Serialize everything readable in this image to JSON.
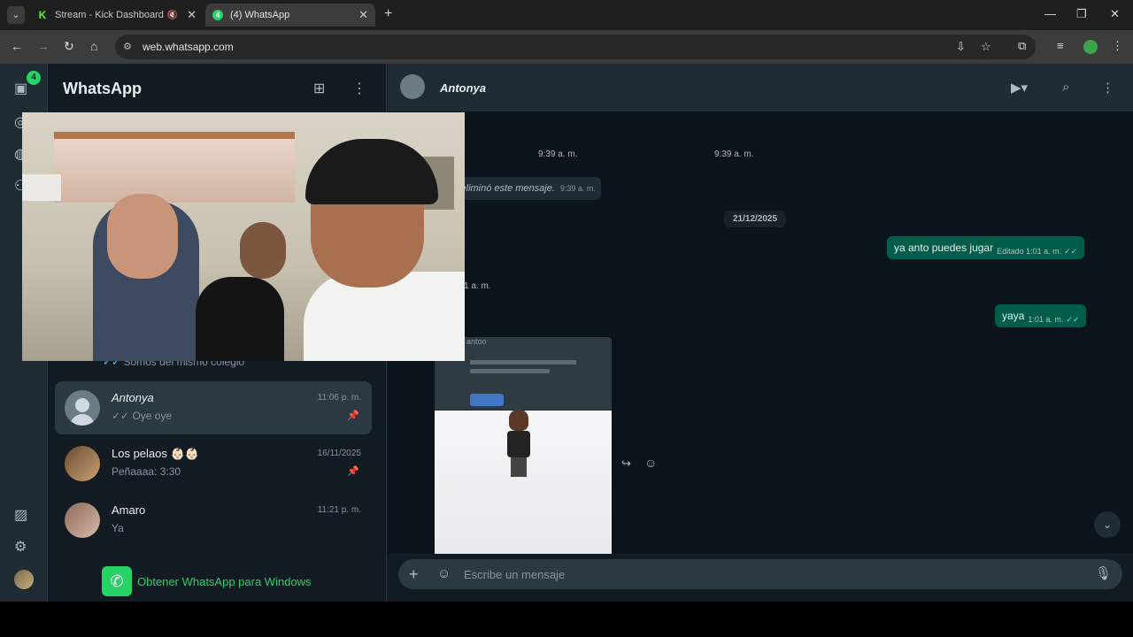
{
  "browser": {
    "tabs": [
      {
        "title": "Stream - Kick Dashboard",
        "favicon": "K"
      },
      {
        "title": "(4) WhatsApp",
        "favicon": "4"
      }
    ],
    "url": "web.whatsapp.com"
  },
  "rail": {
    "unread_badge": "4"
  },
  "sidebar": {
    "brand": "WhatsApp",
    "partial_preview": "Somos del mismo colegio",
    "chats": [
      {
        "name": "Antonya",
        "time": "11:06 p. m.",
        "preview": "✓✓ Oye oye",
        "pinned": true,
        "active": true
      },
      {
        "name": "Los pelaos 👶🏻👶🏻",
        "time": "16/11/2025",
        "preview": "Peñaaaa: 3:30",
        "pinned": true,
        "active": false
      },
      {
        "name": "Amaro",
        "time": "11:21 p. m.",
        "preview": "Ya",
        "pinned": false,
        "active": false
      }
    ],
    "get_app": "Obtener WhatsApp para Windows"
  },
  "chat": {
    "contact": "Antonya",
    "stamps": [
      "9:39 a. m.",
      "9:39 a. m.",
      "1 a. m."
    ],
    "deleted": {
      "text": "Se eliminó este mensaje.",
      "time": "9:39 a. m."
    },
    "date_divider": "21/12/2025",
    "outgoing": [
      {
        "text": "ya anto puedes jugar",
        "meta": "Editado 1:01 a. m."
      },
      {
        "text": "yaya",
        "meta": "1:01 a. m."
      }
    ],
    "media_caption": "antoo",
    "composer_placeholder": "Escribe un mensaje"
  },
  "colors": {
    "accent": "#25d366",
    "outgoing_bubble": "#005c4b",
    "panel": "#202c33",
    "background": "#0b141a"
  }
}
